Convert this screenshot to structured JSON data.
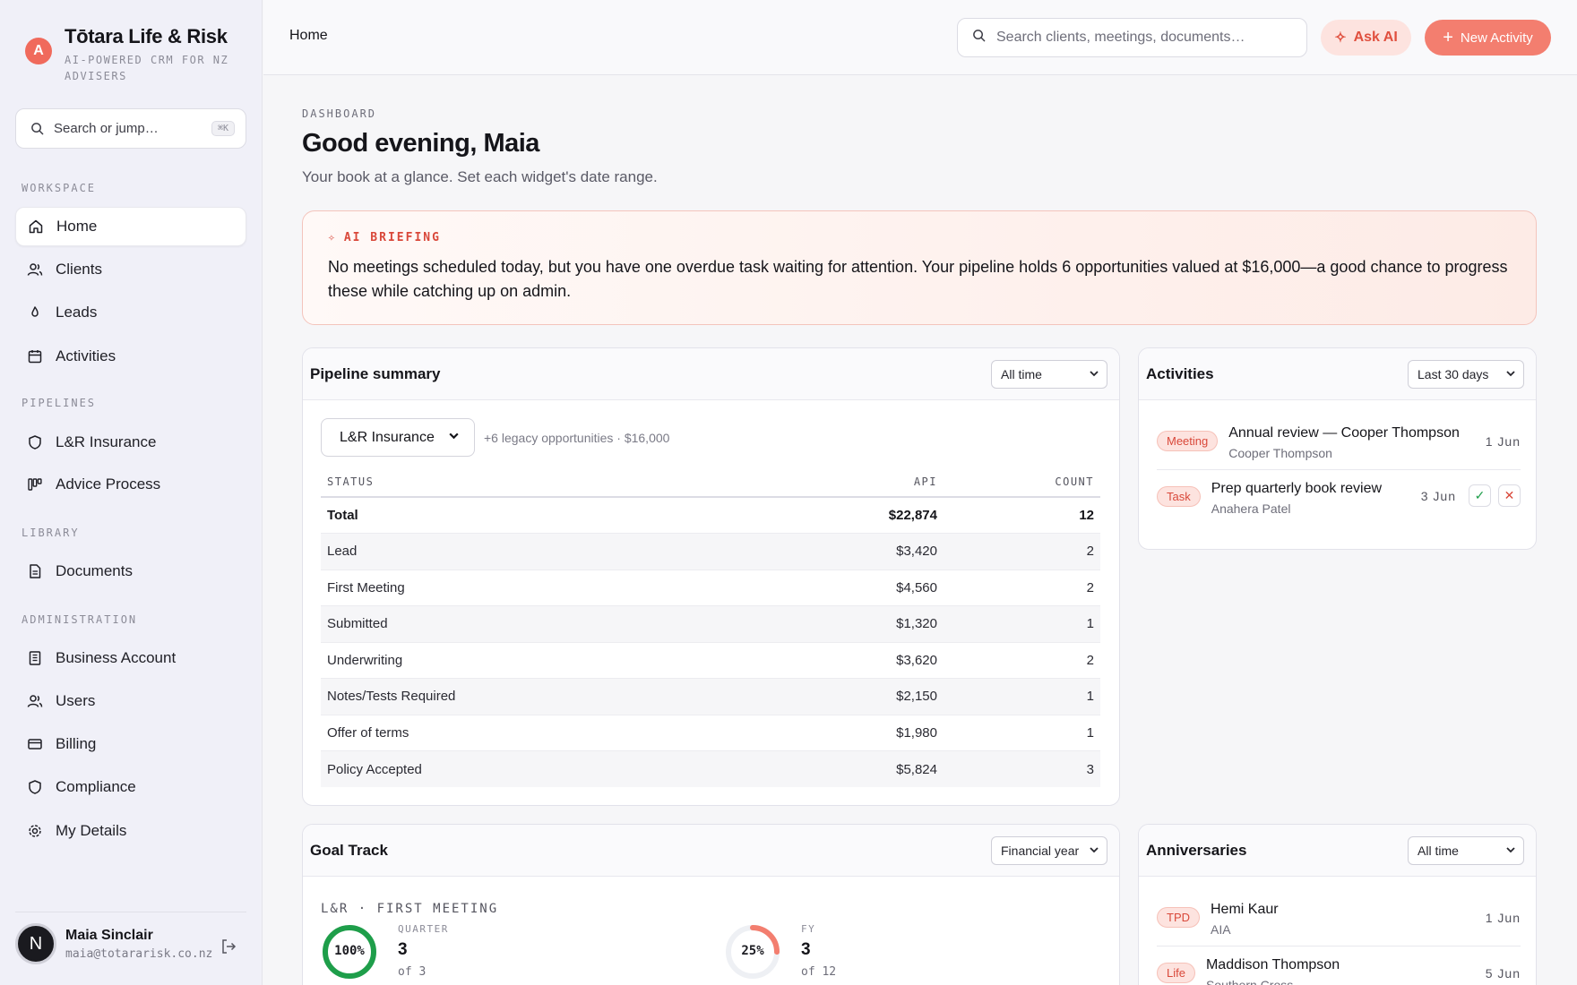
{
  "brand": {
    "logo_letter": "A",
    "name": "Tōtara Life & Risk",
    "tagline": "AI-POWERED CRM FOR NZ ADVISERS"
  },
  "sidebar": {
    "search_placeholder": "Search or jump…",
    "search_shortcut": "⌘K",
    "sections": {
      "workspace": "WORKSPACE",
      "pipelines": "PIPELINES",
      "library": "LIBRARY",
      "administration": "ADMINISTRATION"
    },
    "items": {
      "home": "Home",
      "clients": "Clients",
      "leads": "Leads",
      "activities": "Activities",
      "lr_insurance": "L&R Insurance",
      "advice_process": "Advice Process",
      "documents": "Documents",
      "business_account": "Business Account",
      "users": "Users",
      "billing": "Billing",
      "compliance": "Compliance",
      "my_details": "My Details"
    },
    "user": {
      "initial": "N",
      "name": "Maia Sinclair",
      "email": "maia@totararisk.co.nz"
    }
  },
  "topbar": {
    "breadcrumb": "Home",
    "search_placeholder": "Search clients, meetings, documents…",
    "ask_ai": "Ask AI",
    "new_activity": "New Activity"
  },
  "dashboard": {
    "eyebrow": "DASHBOARD",
    "greeting": "Good evening, Maia",
    "subtitle": "Your book at a glance. Set each widget's date range."
  },
  "briefing": {
    "label": "AI BRIEFING",
    "text": "No meetings scheduled today, but you have one overdue task waiting for attention. Your pipeline holds 6 opportunities valued at $16,000—a good chance to progress these while catching up on admin."
  },
  "pipeline": {
    "title": "Pipeline summary",
    "range": "All time",
    "filter": "L&R Insurance",
    "legacy_note": "+6 legacy opportunities · $16,000",
    "columns": {
      "status": "STATUS",
      "api": "API",
      "count": "COUNT"
    },
    "rows": [
      {
        "status": "Total",
        "api": "$22,874",
        "count": "12"
      },
      {
        "status": "Lead",
        "api": "$3,420",
        "count": "2"
      },
      {
        "status": "First Meeting",
        "api": "$4,560",
        "count": "2"
      },
      {
        "status": "Submitted",
        "api": "$1,320",
        "count": "1"
      },
      {
        "status": "Underwriting",
        "api": "$3,620",
        "count": "2"
      },
      {
        "status": "Notes/Tests Required",
        "api": "$2,150",
        "count": "1"
      },
      {
        "status": "Offer of terms",
        "api": "$1,980",
        "count": "1"
      },
      {
        "status": "Policy Accepted",
        "api": "$5,824",
        "count": "3"
      }
    ]
  },
  "activities": {
    "title": "Activities",
    "range": "Last 30 days",
    "items": [
      {
        "type": "Meeting",
        "title": "Annual review — Cooper Thompson",
        "sub": "Cooper Thompson",
        "date": "1 Jun"
      },
      {
        "type": "Task",
        "title": "Prep quarterly book review",
        "sub": "Anahera Patel",
        "date": "3 Jun"
      }
    ]
  },
  "goal": {
    "title": "Goal Track",
    "range": "Financial year",
    "label": "L&R · FIRST MEETING",
    "quarter": {
      "pct_label": "100%",
      "pct": 100,
      "key": "QUARTER",
      "value": "3",
      "sub": "of 3"
    },
    "fy": {
      "pct_label": "25%",
      "pct": 25,
      "key": "FY",
      "value": "3",
      "sub": "of 12"
    }
  },
  "anniversaries": {
    "title": "Anniversaries",
    "range": "All time",
    "items": [
      {
        "type": "TPD",
        "name": "Hemi Kaur",
        "sub": "AIA",
        "date": "1 Jun"
      },
      {
        "type": "Life",
        "name": "Maddison Thompson",
        "sub": "Southern Cross",
        "date": "5 Jun"
      }
    ]
  },
  "colors": {
    "accent": "#f06a5c",
    "success": "#1e9e4a",
    "sidebar_bg": "#f0f0f8"
  }
}
